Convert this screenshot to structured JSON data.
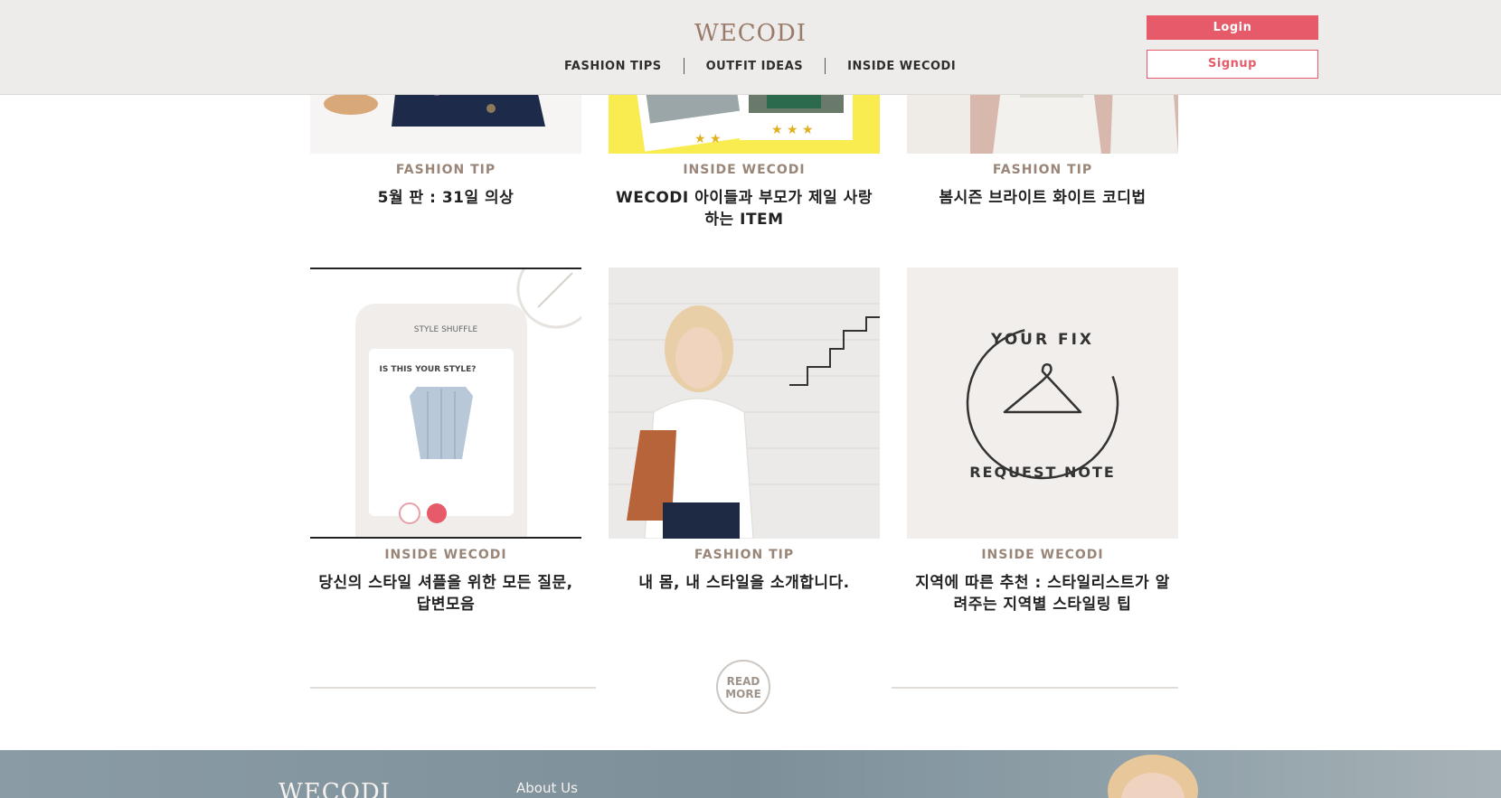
{
  "header": {
    "logo": "WECODI",
    "nav": [
      "FASHION TIPS",
      "OUTFIT IDEAS",
      "INSIDE WECODI"
    ],
    "login_label": "Login",
    "signup_label": "Signup"
  },
  "colors": {
    "accent": "#e65a69",
    "category": "#9a8678",
    "header_bg": "#eeecea"
  },
  "cards": [
    {
      "category": "FASHION TIP",
      "title": "5월 판 : 31일 의상"
    },
    {
      "category": "INSIDE WECODI",
      "title": "WECODI 아이들과 부모가 제일 사랑하는 ITEM"
    },
    {
      "category": "FASHION TIP",
      "title": "봄시즌 브라이트 화이트 코디법"
    },
    {
      "category": "INSIDE WECODI",
      "title": "당신의 스타일 셔플을 위한 모든 질문, 답변모음",
      "image": {
        "header": "STYLE SHUFFLE",
        "question": "IS THIS YOUR STYLE?"
      }
    },
    {
      "category": "FASHION TIP",
      "title": "내 몸, 내 스타일을 소개합니다."
    },
    {
      "category": "INSIDE WECODI",
      "title": "지역에 따른 추천 : 스타일리스트가 알려주는 지역별 스타일링 팁",
      "image": {
        "text_top": "YOUR FIX",
        "text_bottom": "REQUEST NOTE"
      }
    }
  ],
  "read_more": {
    "line1": "READ",
    "line2": "MORE"
  },
  "footer": {
    "logo": "WECODI",
    "link": "About Us"
  }
}
